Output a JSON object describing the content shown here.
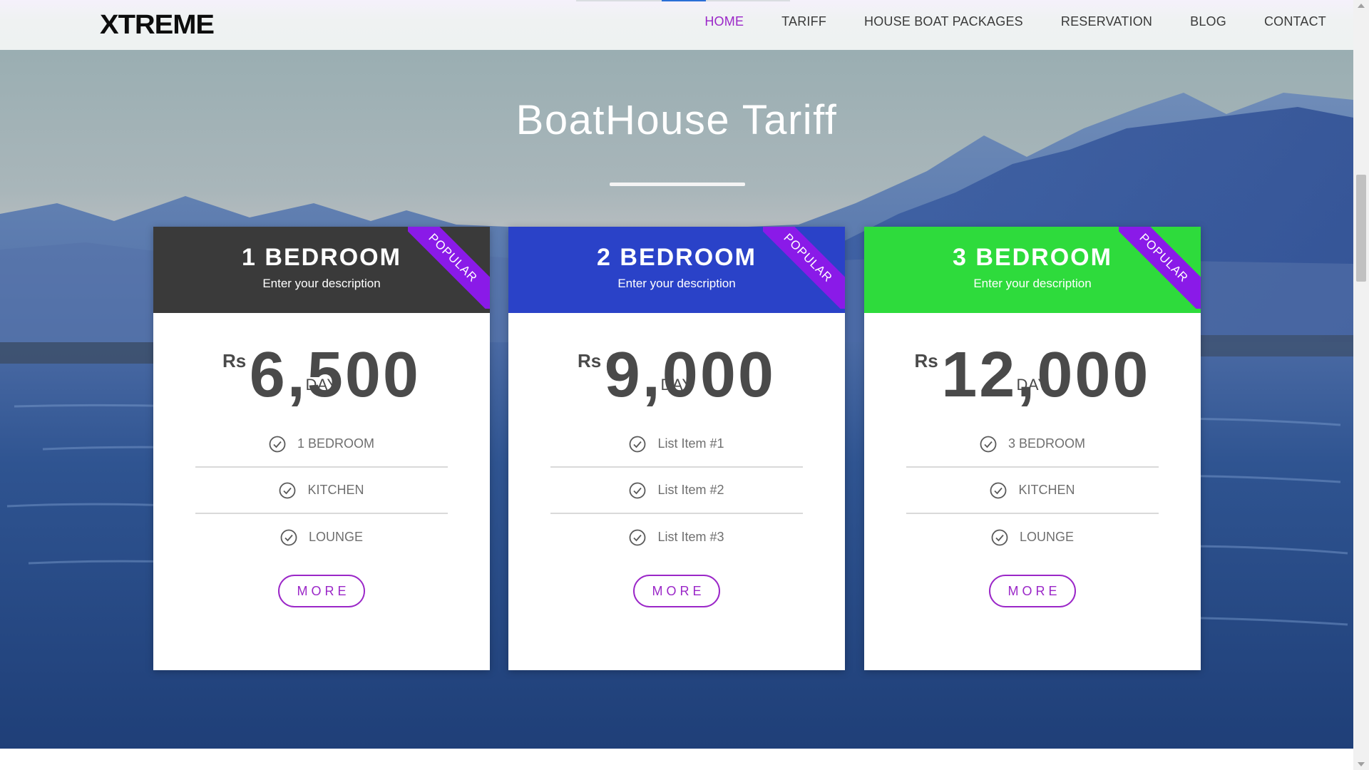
{
  "navbar": {
    "logo_text": "XTREME",
    "links": [
      {
        "label": "HOME",
        "active": true
      },
      {
        "label": "TARIFF",
        "active": false
      },
      {
        "label": "HOUSE BOAT PACKAGES",
        "active": false
      },
      {
        "label": "RESERVATION",
        "active": false
      },
      {
        "label": "BLOG",
        "active": false
      },
      {
        "label": "CONTACT",
        "active": false
      }
    ]
  },
  "hero": {
    "title": "BoatHouse Tariff"
  },
  "cards": [
    {
      "title": "1 BEDROOM",
      "description": "Enter your description",
      "ribbon": "POPULAR",
      "currency": "Rs",
      "amount": "6,500",
      "period": "DAY",
      "features": [
        "1 BEDROOM",
        "KITCHEN",
        "LOUNGE"
      ],
      "button": "MORE",
      "header_color": "#3a3a3a"
    },
    {
      "title": "2 BEDROOM",
      "description": "Enter your description",
      "ribbon": "POPULAR",
      "currency": "Rs",
      "amount": "9,000",
      "period": "DAY",
      "features": [
        "List Item #1",
        "List Item #2",
        "List Item #3"
      ],
      "button": "MORE",
      "header_color": "#2a42c8"
    },
    {
      "title": "3 BEDROOM",
      "description": "Enter your description",
      "ribbon": "POPULAR",
      "currency": "Rs",
      "amount": "12,000",
      "period": "DAY",
      "features": [
        "3 BEDROOM",
        "KITCHEN",
        "LOUNGE"
      ],
      "button": "MORE",
      "header_color": "#2edb3c"
    }
  ],
  "colors": {
    "accent": "#9b27c8",
    "ribbon": "#8a1ae8",
    "text_dark": "#4a4a4a"
  },
  "icons": {
    "feature_check": "check-circle-icon",
    "logo_mark": "x-logo-icon"
  }
}
